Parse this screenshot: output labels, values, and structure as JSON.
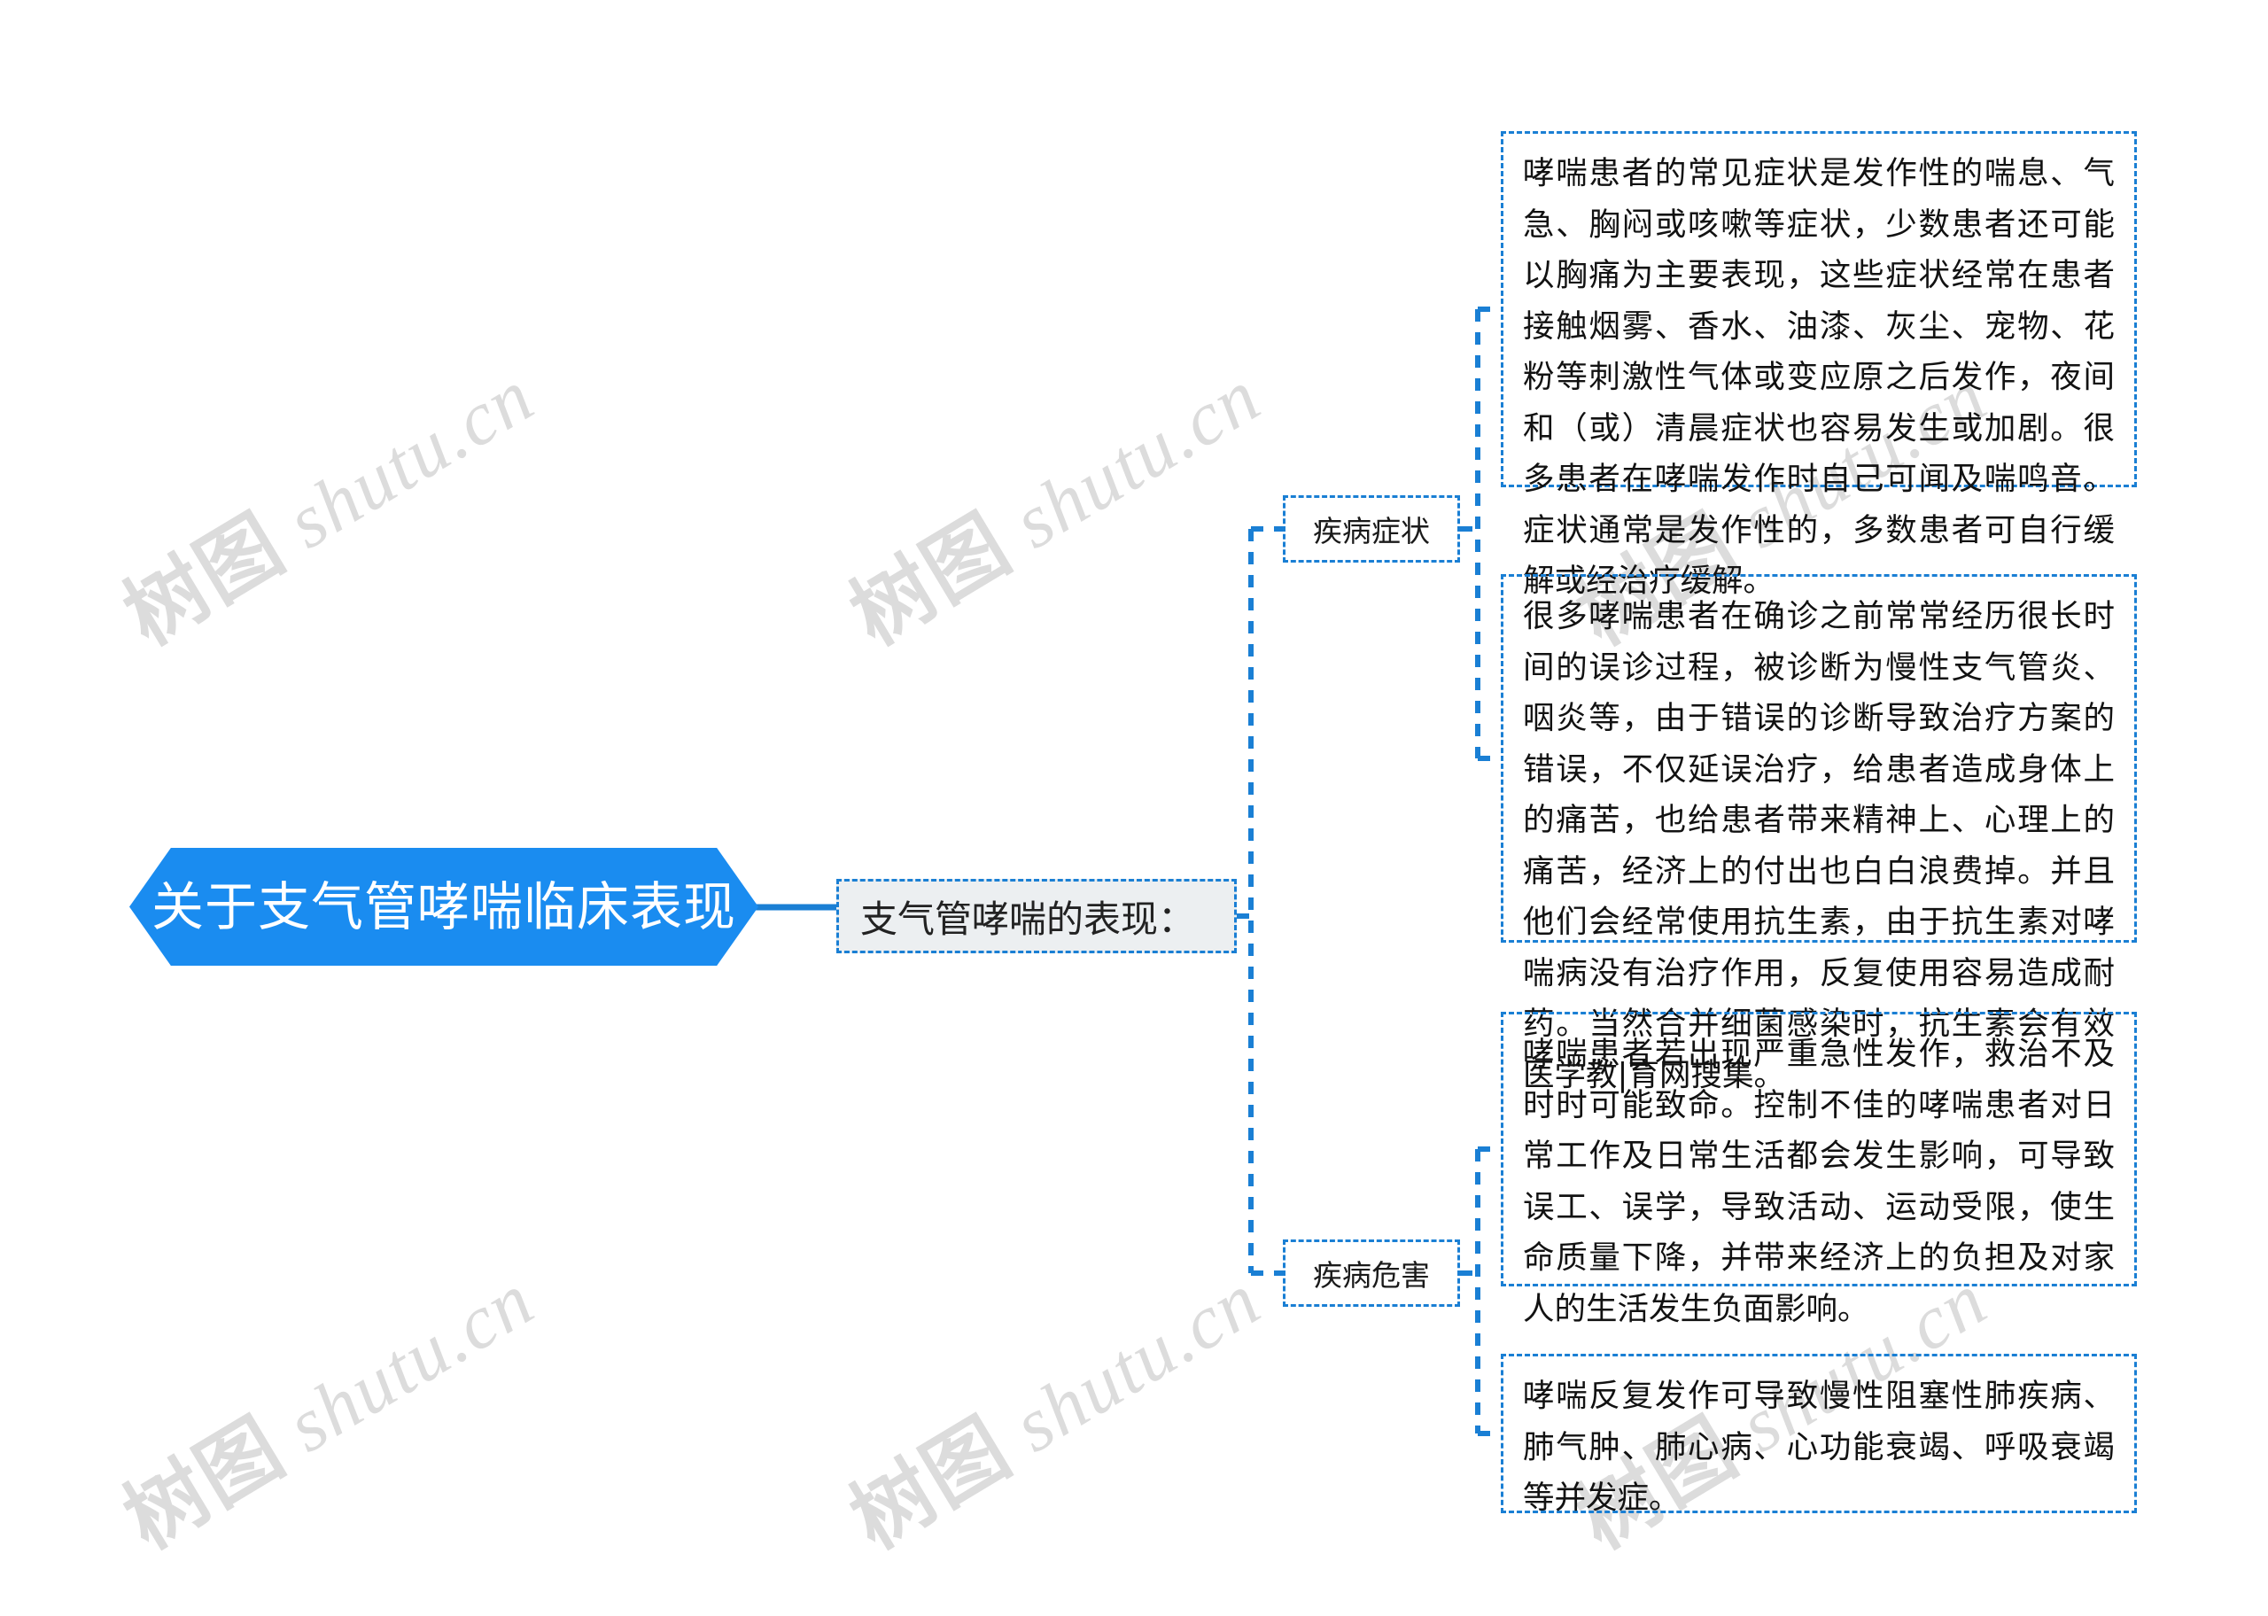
{
  "colors": {
    "brand_blue": "#1a8cf0",
    "link_blue": "#1a7fd4",
    "node_fill_gray": "#eceff1",
    "watermark_gray": "#dcdcdc",
    "text_dark": "#121212",
    "page_background": "#ffffff"
  },
  "watermark": {
    "cjk": "树图",
    "latin": "shutu.cn"
  },
  "root": {
    "label": "关于支气管哮喘临床表现"
  },
  "level1": {
    "label": "支气管哮喘的表现："
  },
  "branches": [
    {
      "label": "疾病症状",
      "leaves": [
        "哮喘患者的常见症状是发作性的喘息、气急、胸闷或咳嗽等症状，少数患者还可能以胸痛为主要表现，这些症状经常在患者接触烟雾、香水、油漆、灰尘、宠物、花粉等刺激性气体或变应原之后发作，夜间和（或）清晨症状也容易发生或加剧。很多患者在哮喘发作时自己可闻及喘鸣音。症状通常是发作性的，多数患者可自行缓解或经治疗缓解。",
        "很多哮喘患者在确诊之前常常经历很长时间的误诊过程，被诊断为慢性支气管炎、咽炎等，由于错误的诊断导致治疗方案的错误，不仅延误治疗，给患者造成身体上的痛苦，也给患者带来精神上、心理上的痛苦，经济上的付出也白白浪费掉。并且他们会经常使用抗生素，由于抗生素对哮喘病没有治疗作用，反复使用容易造成耐药。当然合并细菌感染时，抗生素会有效医学教|育网搜集。"
      ]
    },
    {
      "label": "疾病危害",
      "leaves": [
        "哮喘患者若出现严重急性发作，救治不及时时可能致命。控制不佳的哮喘患者对日常工作及日常生活都会发生影响，可导致误工、误学，导致活动、运动受限，使生命质量下降，并带来经济上的负担及对家人的生活发生负面影响。",
        "哮喘反复发作可导致慢性阻塞性肺疾病、肺气肿、肺心病、心功能衰竭、呼吸衰竭等并发症。"
      ]
    }
  ]
}
